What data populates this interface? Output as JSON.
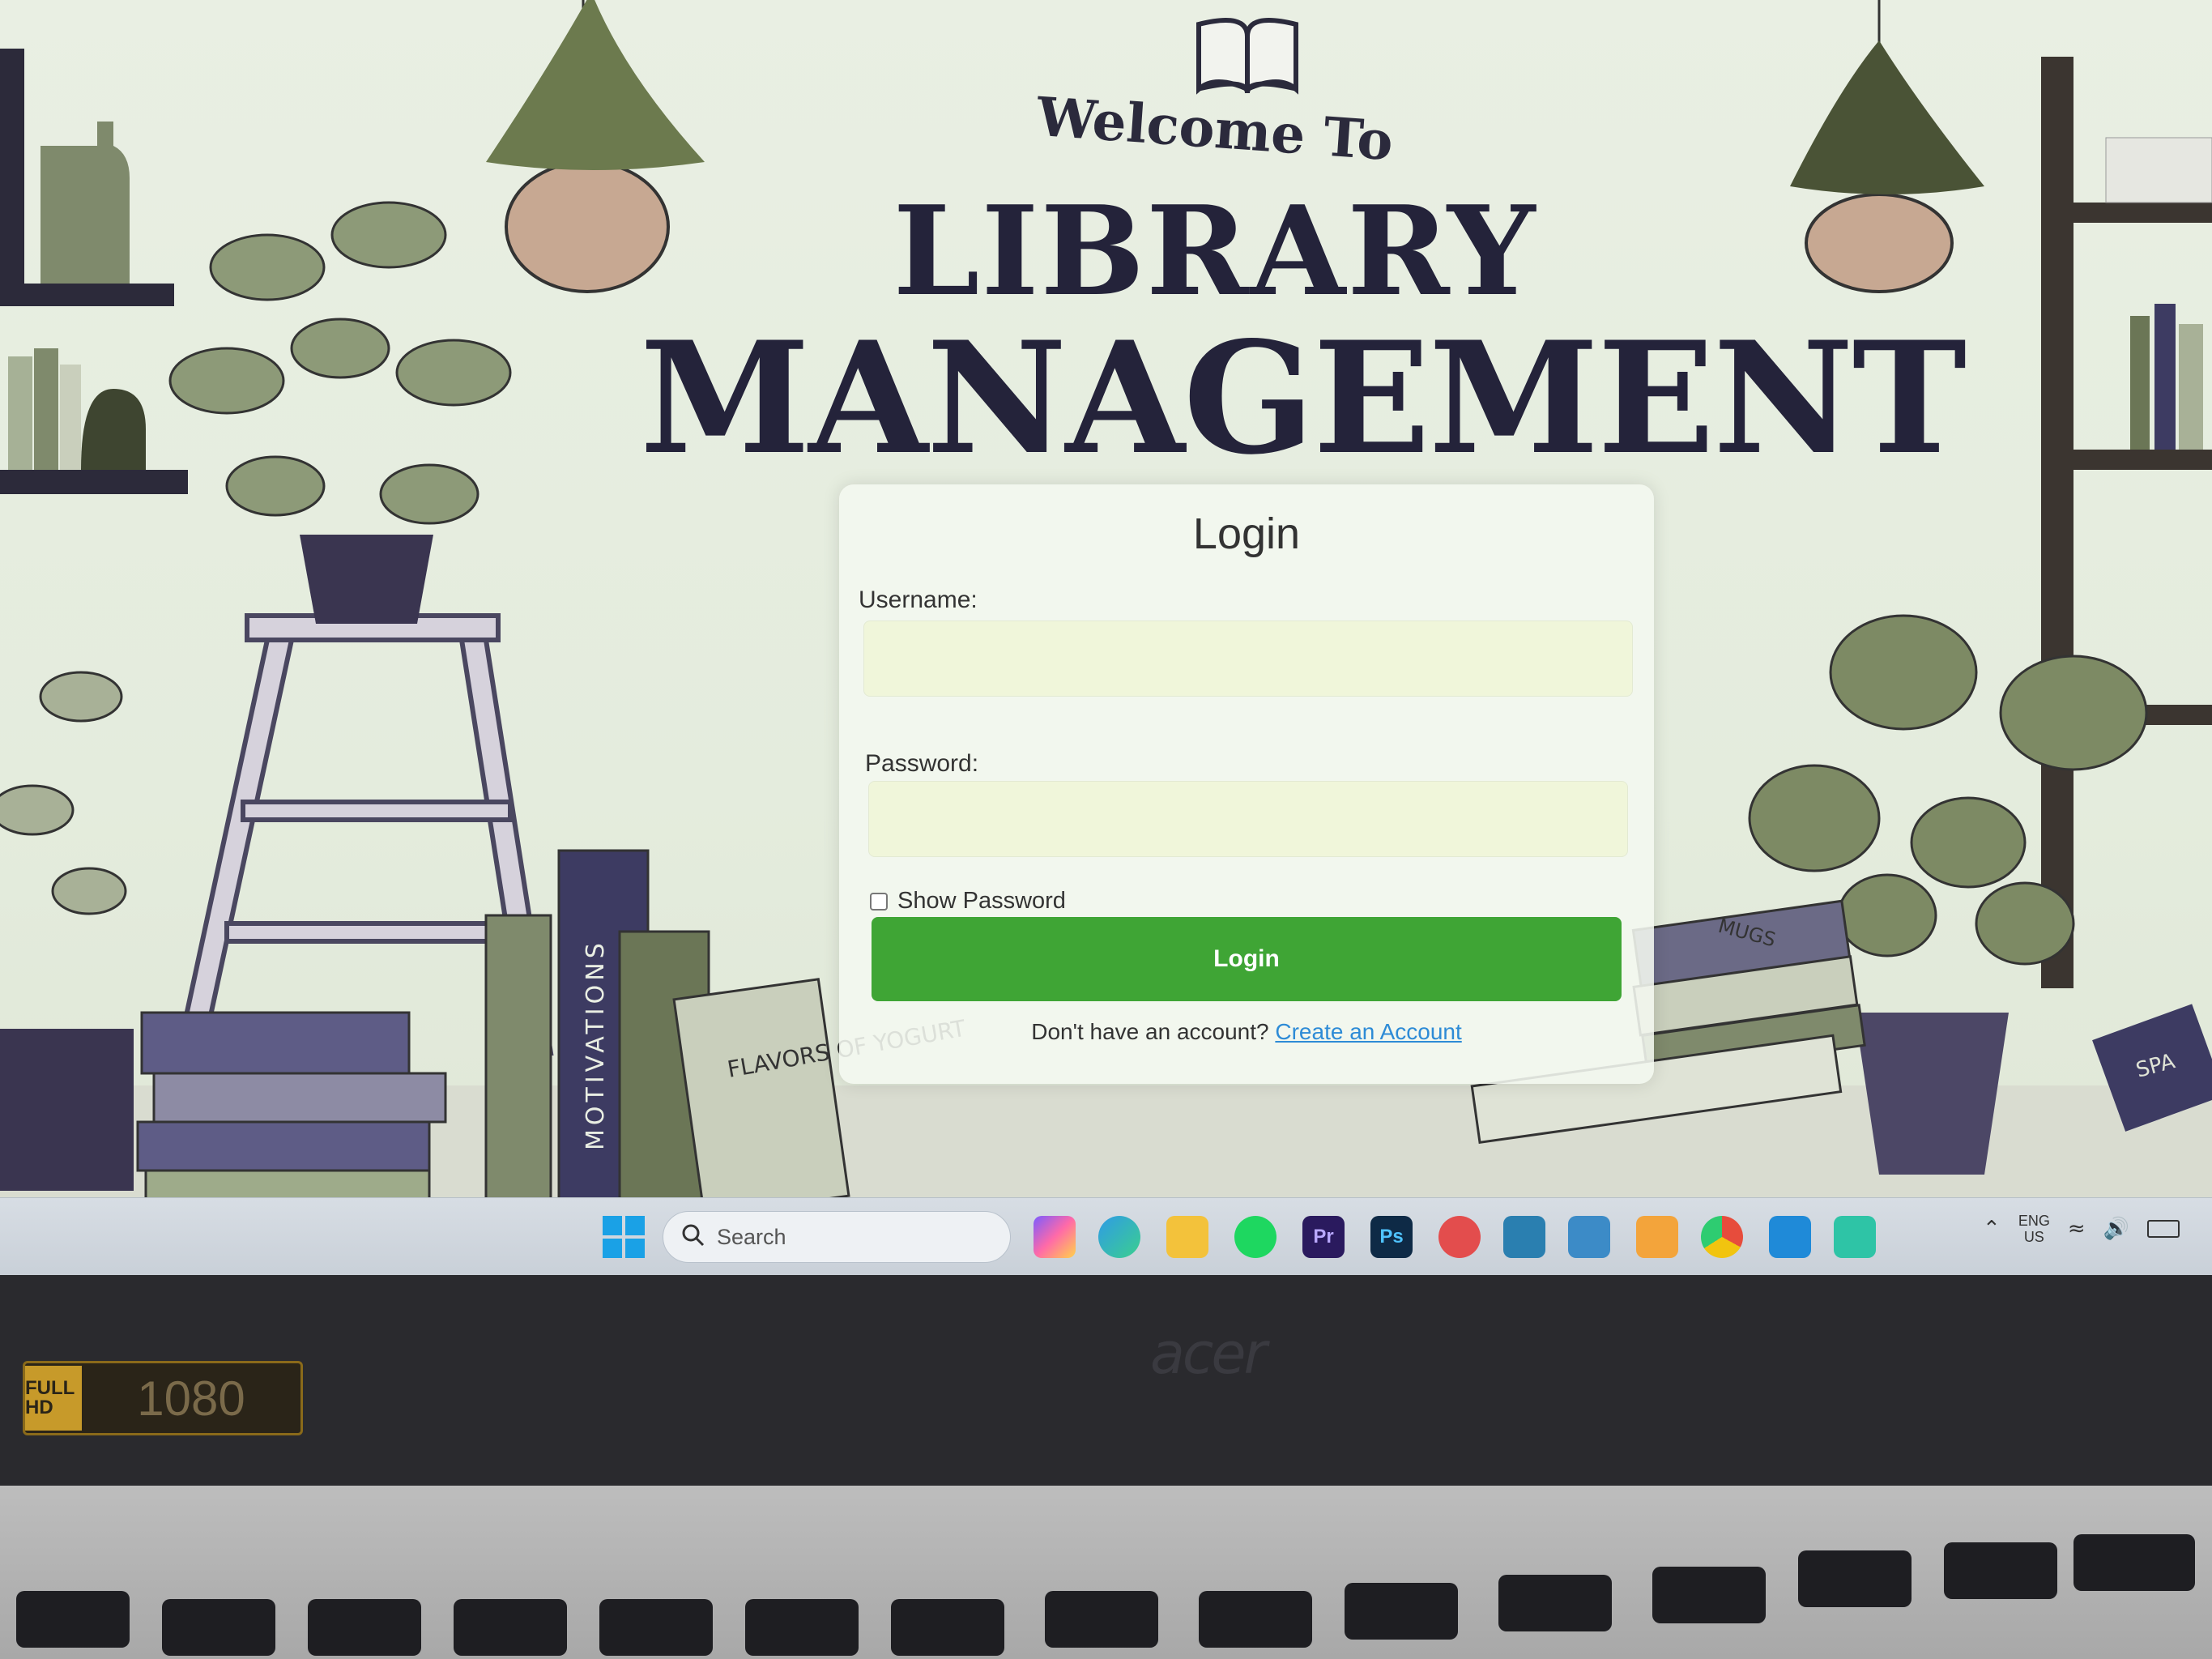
{
  "welcome": "Welcome To",
  "title_line1": "LIBRARY",
  "title_line2": "MANAGEMENT",
  "login_form": {
    "heading": "Login",
    "username_label": "Username:",
    "username_value": "",
    "password_label": "Password:",
    "password_value": "",
    "show_password_label": "Show Password",
    "show_password_checked": false,
    "submit_label": "Login",
    "signup_prompt": "Don't have an account?",
    "signup_link": "Create an Account"
  },
  "illustration": {
    "book_spine_1": "MOTIVATIONS",
    "book_cover_1": "FLAVORS OF YOGURT",
    "book_top_right": "MUGS",
    "book_right_edge": "SPA"
  },
  "taskbar": {
    "search_placeholder": "Search",
    "apps": [
      "copilot-icon",
      "edge-icon",
      "file-explorer-icon",
      "spotify-icon",
      "premiere-icon",
      "photoshop-icon",
      "pinterest-icon",
      "snipping-tool-icon",
      "remote-desktop-icon",
      "mail-icon",
      "chrome-icon",
      "vscode-icon",
      "notepad-icon"
    ],
    "premiere_text": "Pr",
    "photoshop_text": "Ps",
    "lang_line1": "ENG",
    "lang_line2": "US"
  },
  "laptop": {
    "brand": "acer",
    "sticker_left": "FULL HD",
    "sticker_right": "1080"
  },
  "colors": {
    "accent_green": "#3fa535",
    "link_blue": "#2d8bd6",
    "title_ink": "#24233a",
    "input_bg": "#f0f6da"
  }
}
